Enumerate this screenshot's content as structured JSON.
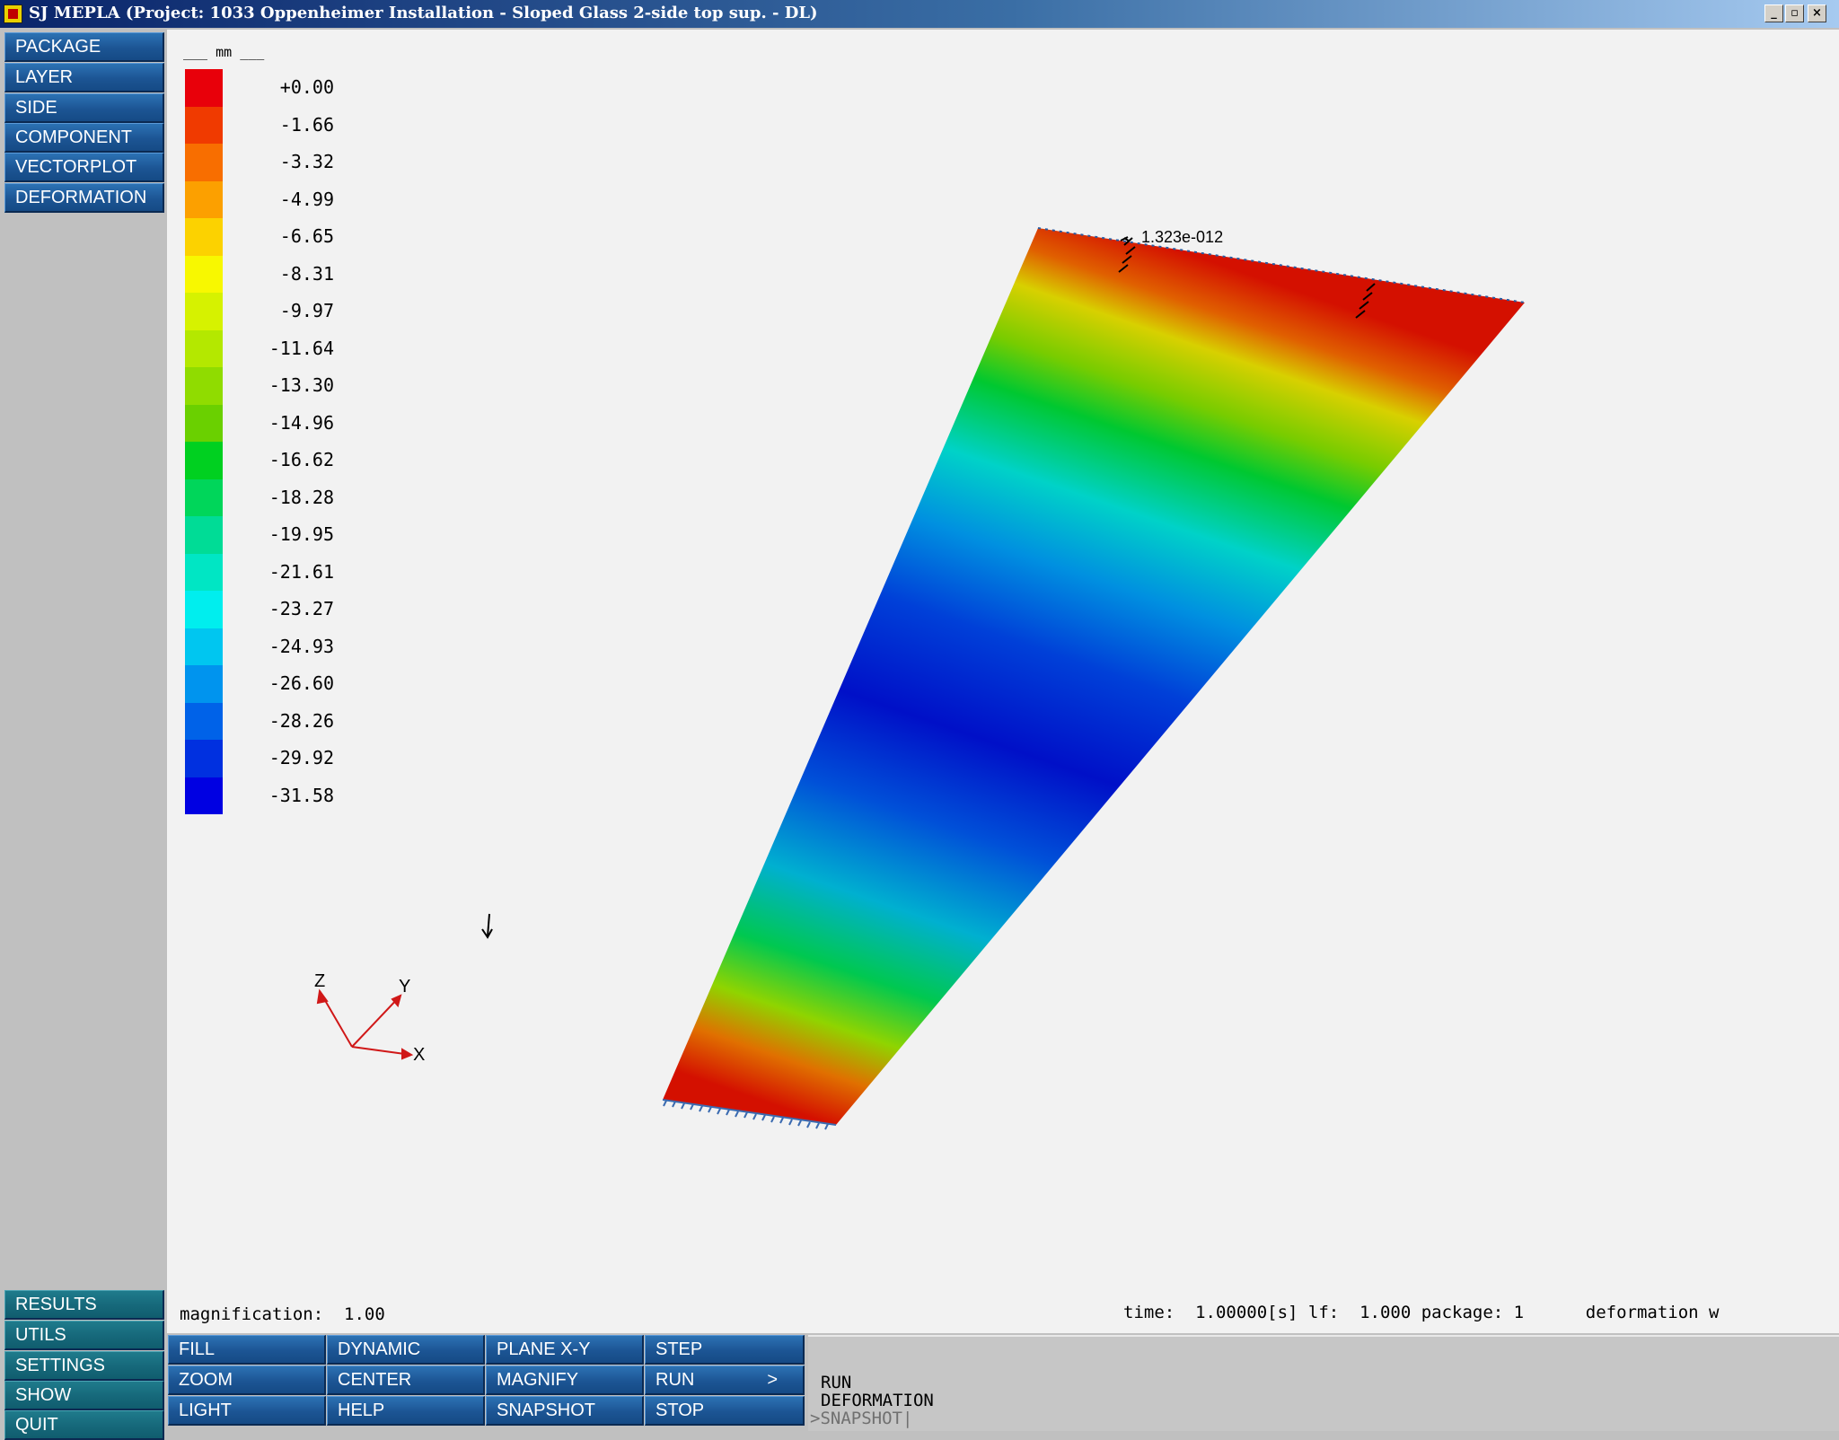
{
  "titlebar": {
    "title": "SJ MEPLA (Project: 1033 Oppenheimer Installation - Sloped Glass 2-side top sup. - DL)",
    "minimize": "_",
    "restore": "▫",
    "close": "×"
  },
  "side_menu_top": [
    "PACKAGE",
    "LAYER",
    "SIDE",
    "COMPONENT",
    "VECTORPLOT",
    "DEFORMATION"
  ],
  "side_menu_bottom": [
    "RESULTS",
    "UTILS",
    "SETTINGS",
    "SHOW",
    "QUIT"
  ],
  "toolbar": [
    [
      "FILL",
      "DYNAMIC",
      "PLANE X-Y",
      "STEP"
    ],
    [
      "ZOOM",
      "CENTER",
      "MAGNIFY",
      "RUN"
    ],
    [
      "LIGHT",
      "HELP",
      "SNAPSHOT",
      "STOP"
    ]
  ],
  "toolbar_run_arrow": ">",
  "legend": {
    "unit": "___ mm ___",
    "labels": [
      "+0.00",
      "-1.66",
      "-3.32",
      "-4.99",
      "-6.65",
      "-8.31",
      "-9.97",
      "-11.64",
      "-13.30",
      "-14.96",
      "-16.62",
      "-18.28",
      "-19.95",
      "-21.61",
      "-23.27",
      "-24.93",
      "-26.60",
      "-28.26",
      "-29.92",
      "-31.58"
    ],
    "colors": [
      "#e8000a",
      "#f03a00",
      "#f86e00",
      "#fca000",
      "#fcd200",
      "#f8f800",
      "#d6f200",
      "#b4e800",
      "#90dc00",
      "#6ad000",
      "#00d020",
      "#00d65a",
      "#00dc96",
      "#00e6c4",
      "#00eeee",
      "#00c6f0",
      "#0094ee",
      "#0062e8",
      "#0030e0",
      "#0000e2"
    ]
  },
  "plot": {
    "annotation": "1.323e-012",
    "axes": {
      "x": "X",
      "y": "Y",
      "z": "Z"
    }
  },
  "status": {
    "magnification": "magnification:  1.00",
    "time_info": "time:  1.00000[s] lf:  1.000 package: 1      deformation w"
  },
  "command_history": [
    "RUN",
    "DEFORMATION",
    ">SNAPSHOT|"
  ]
}
